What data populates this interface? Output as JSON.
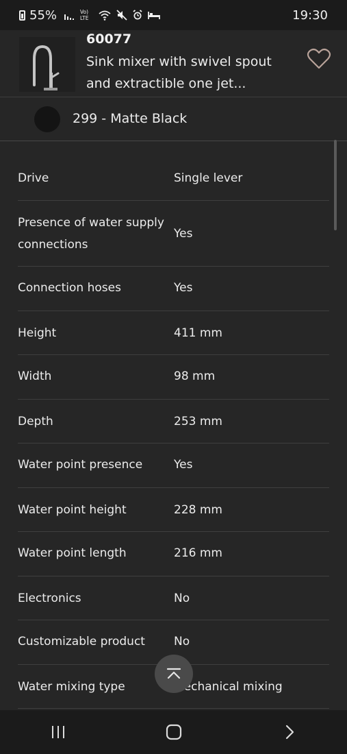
{
  "status_bar": {
    "battery": "55%",
    "time": "19:30",
    "icons": [
      "signal-bars-icon",
      "volte-lte-icon",
      "wifi-icon",
      "mute-icon",
      "alarm-icon",
      "bed-icon"
    ],
    "volte_top": "Vo)",
    "volte_bottom": "LTE"
  },
  "product": {
    "code": "60077",
    "name": "Sink mixer with swivel spout and extractible one jet...",
    "favorite_icon": "heart-outline-icon"
  },
  "variant": {
    "label": "299 - Matte Black",
    "swatch_color": "#141414"
  },
  "specs": [
    {
      "label": "Drive",
      "value": "Single lever"
    },
    {
      "label": "Presence of water supply connections",
      "value": "Yes"
    },
    {
      "label": "Connection hoses",
      "value": "Yes"
    },
    {
      "label": "Height",
      "value": "411 mm"
    },
    {
      "label": "Width",
      "value": "98 mm"
    },
    {
      "label": "Depth",
      "value": "253 mm"
    },
    {
      "label": "Water point presence",
      "value": "Yes"
    },
    {
      "label": "Water point height",
      "value": "228 mm"
    },
    {
      "label": "Water point length",
      "value": "216 mm"
    },
    {
      "label": "Electronics",
      "value": "No"
    },
    {
      "label": "Customizable product",
      "value": "No"
    },
    {
      "label": "Water mixing type",
      "value": "Mechanical mixing"
    }
  ],
  "colors": {
    "background": "#262626",
    "text": "#ececec",
    "divider": "#3f3f3f",
    "favorite_outline": "#b9a39a"
  },
  "controls": {
    "scroll_to_top_icon": "chevron-up-icon",
    "nav_icons": [
      "recent-apps-icon",
      "home-icon",
      "back-icon"
    ]
  }
}
